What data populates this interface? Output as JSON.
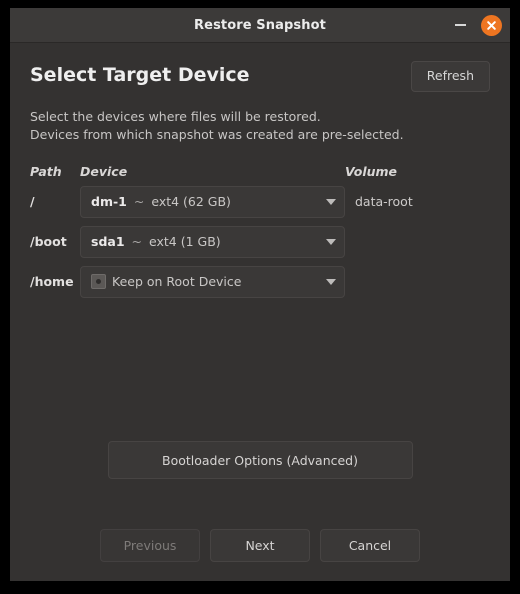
{
  "window": {
    "title": "Restore Snapshot",
    "minimize_icon": "minimize-icon",
    "close_icon": "close-icon",
    "accent_color": "#ee7521",
    "titlebar_color": "#3c3a39",
    "background_color": "#343231"
  },
  "header": {
    "title": "Select Target Device",
    "refresh_label": "Refresh"
  },
  "description": {
    "line1": "Select the devices where files will be restored.",
    "line2": "Devices from which snapshot was created are pre-selected."
  },
  "table": {
    "columns": {
      "path": "Path",
      "device": "Device",
      "volume": "Volume"
    },
    "rows": [
      {
        "path": "/",
        "device_name": "dm-1",
        "device_separator": "~",
        "device_detail": "ext4 (62 GB)",
        "device_full": "dm-1 ~ ext4 (62 GB)",
        "volume": "data-root",
        "icon": null,
        "dropdown_icon": "chevron-down-icon"
      },
      {
        "path": "/boot",
        "device_name": "sda1",
        "device_separator": "~",
        "device_detail": "ext4 (1 GB)",
        "device_full": "sda1 ~ ext4 (1 GB)",
        "volume": "",
        "icon": null,
        "dropdown_icon": "chevron-down-icon"
      },
      {
        "path": "/home",
        "device_name": "",
        "device_separator": "",
        "device_detail": "Keep on Root Device",
        "device_full": "Keep on Root Device",
        "volume": "",
        "icon": "disk-icon",
        "dropdown_icon": "chevron-down-icon"
      }
    ]
  },
  "bootloader": {
    "label": "Bootloader Options (Advanced)"
  },
  "footer": {
    "previous_label": "Previous",
    "previous_enabled": false,
    "next_label": "Next",
    "cancel_label": "Cancel"
  }
}
